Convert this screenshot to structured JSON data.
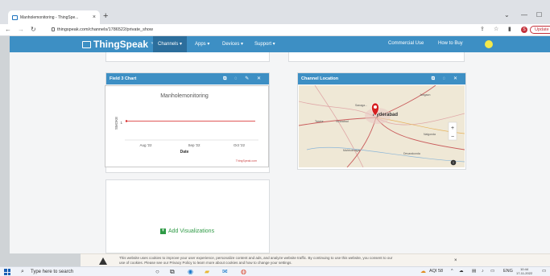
{
  "browser": {
    "tab_title": "Manholemonitoring - ThingSpe...",
    "tab_close": "×",
    "new_tab": "+",
    "url": "thingspeak.com/channels/1786522/private_show",
    "update_label": "Update",
    "avatar_letter": "S"
  },
  "site": {
    "brand": "ThingSpeak",
    "brand_tm": "™",
    "nav": [
      {
        "label": "Channels ▾"
      },
      {
        "label": "Apps ▾"
      },
      {
        "label": "Devices ▾"
      },
      {
        "label": "Support ▾"
      }
    ],
    "commercial": "Commercial Use",
    "howtobuy": "How to Buy"
  },
  "field3": {
    "header": "Field 3 Chart",
    "tools": "⧉ ◌ ✎ ✕"
  },
  "location": {
    "header": "Channel Location",
    "tools": "⧉ ◌ ✕",
    "places": [
      {
        "label": "Sanaga..."
      },
      {
        "label": "Jangaon"
      },
      {
        "label": "Tandur"
      },
      {
        "label": "Vicarabad"
      },
      {
        "label": "Hyderabad"
      },
      {
        "label": "Nalgonda"
      },
      {
        "label": "Mahbubnagar"
      },
      {
        "label": "Devarakonda"
      }
    ],
    "zoom_in": "+",
    "zoom_out": "−",
    "info": "i"
  },
  "add_viz": "Add Visualizations",
  "cookie": {
    "text_line1": "This website uses cookies to improve your user experience, personalize content and ads, and analyze website traffic. By continuing to use this website, you consent to our",
    "text_line2": "use of cookies. Please see our Privacy Policy to learn more about cookies and how to change your settings.",
    "close": "×"
  },
  "taskbar": {
    "search_placeholder": "Type here to search",
    "aqi": "AQI 58",
    "lang": "ENG",
    "time": "10:44",
    "date": "17-11-2022"
  },
  "chart_data": {
    "type": "line",
    "title": "Manholemonitoring",
    "xlabel": "Date",
    "ylabel": "SMOKE",
    "x_ticks": [
      "Aug '22",
      "Sep '22",
      "Oct '22"
    ],
    "y_ticks": [
      "1"
    ],
    "ylim": [
      0,
      2
    ],
    "series": [
      {
        "values": [
          1,
          1,
          1,
          1,
          1,
          1,
          1
        ]
      }
    ],
    "credit": "ThingSpeak.com",
    "color": "#d62020"
  }
}
